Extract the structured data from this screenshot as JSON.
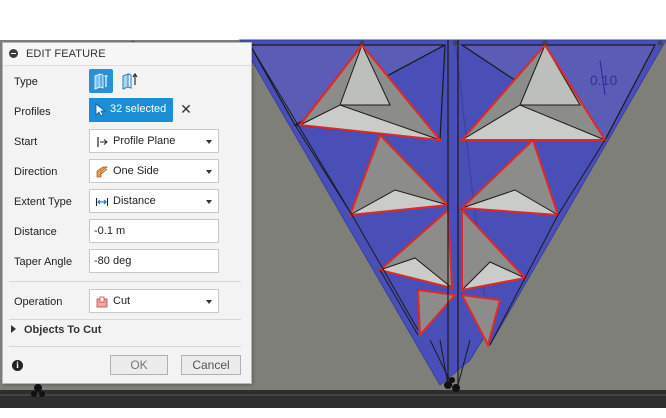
{
  "viewport": {
    "dimension_label": "0.10",
    "colors": {
      "background": "#7f7f7a",
      "bottom_band": "#2e2e2e",
      "face_blue": "#4a4fb8",
      "face_blue_dark": "#3d42a8",
      "face_gray": "#8c8c8a",
      "face_light": "#c9ccc9",
      "selection_red": "#e02828",
      "edge": "#1a1a1a"
    }
  },
  "panel": {
    "title": "EDIT FEATURE",
    "collapse_icon": "minus-circle-icon",
    "rows": {
      "type": {
        "label": "Type",
        "options": [
          "solid-extrude-icon",
          "surface-extrude-icon"
        ],
        "selected": "solid-extrude-icon"
      },
      "profiles": {
        "label": "Profiles",
        "value": "32 selected",
        "clear_icon": "close-icon",
        "clear_glyph": "✕"
      },
      "start": {
        "label": "Start",
        "value": "Profile Plane",
        "icon": "profile-plane-icon"
      },
      "direction": {
        "label": "Direction",
        "value": "One Side",
        "icon": "one-side-icon"
      },
      "extent_type": {
        "label": "Extent Type",
        "value": "Distance",
        "icon": "distance-icon"
      },
      "distance": {
        "label": "Distance",
        "value": "-0.1 m"
      },
      "taper_angle": {
        "label": "Taper Angle",
        "value": "-80 deg"
      },
      "operation": {
        "label": "Operation",
        "value": "Cut",
        "icon": "cut-icon"
      }
    },
    "objects_to_cut": {
      "label": "Objects To Cut"
    },
    "footer": {
      "info_icon": "info-icon",
      "info_glyph": "i",
      "ok_label": "OK",
      "cancel_label": "Cancel"
    }
  }
}
